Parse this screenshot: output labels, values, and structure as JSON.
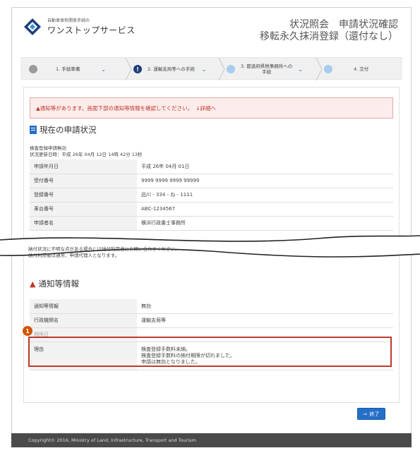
{
  "header": {
    "logo_small": "自動車保有関係手続の",
    "logo_main": "ワンストップサービス",
    "title_line1": "状況照会　申請状況確認",
    "title_line2": "移転永久抹消登録（還付なし）"
  },
  "stepper": {
    "steps": [
      {
        "label": "1. 手続準備",
        "icon": "check-circle-icon"
      },
      {
        "label": "2. 運輸支局等への手続",
        "icon": "exclamation-icon"
      },
      {
        "label_line1": "3. 都道府県税事務所への",
        "label_line2": "手続",
        "icon": "pending-icon"
      },
      {
        "label": "4. 交付",
        "icon": "pending-icon"
      }
    ]
  },
  "alert": {
    "text": "▲通知等があります。画面下部の通知等情報を確認してください。",
    "link": "↓詳細へ"
  },
  "status_section": {
    "title": "現在の申請状況",
    "status_line": "検査登録申請無効",
    "updated_line": "状況更新日時：平成 26年 04月 12日 14時 42分 13秒",
    "rows": [
      {
        "key": "申請年月日",
        "value": "平成 26年 04月 01日"
      },
      {
        "key": "受付番号",
        "value": "9999 9999 9999 99999"
      },
      {
        "key": "登録番号",
        "value": "品川 - 334 - ね - 1111"
      },
      {
        "key": "車台番号",
        "value": "ABC-1234567"
      },
      {
        "key": "申請者名",
        "value": "横浜行政書士事務所"
      }
    ]
  },
  "notes": {
    "line1": "納付状況に不明な点がある場合には納付利用者にお問い合わせください。",
    "line2": "納付利用者は通常、申請代理人となります。"
  },
  "notice_section": {
    "title": "通知等情報",
    "rows": [
      {
        "key": "通知等情報",
        "value": "無効"
      },
      {
        "key": "行政機関名",
        "value": "運輸支局等"
      },
      {
        "key": "期限日",
        "value": ""
      }
    ],
    "reason_key": "理由",
    "reason_lines": [
      "検査登録手数料未納。",
      "検査登録手数料の納付期限が切れました。",
      "申請は無効となりました。"
    ]
  },
  "badge": "1",
  "end_button": "終了",
  "footer": "Copyright© 2016, Ministry of Land, Infrastructure, Transport and Tourism",
  "colors": {
    "accent": "#2470c8",
    "alert_red": "#c0392b",
    "badge_orange": "#d35400",
    "footer_bg": "#4a4a4a"
  }
}
